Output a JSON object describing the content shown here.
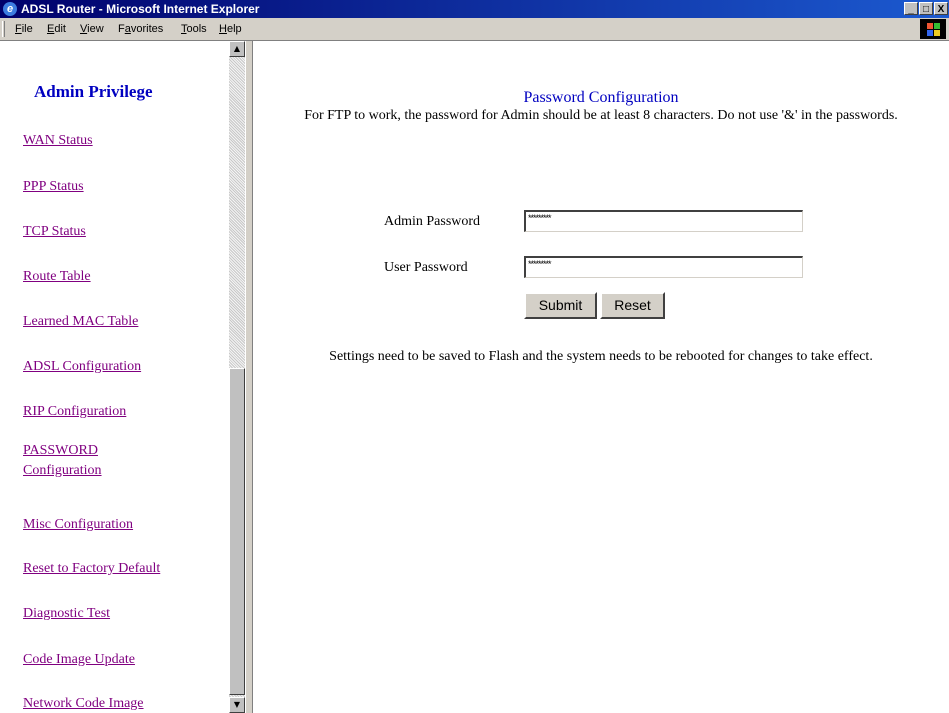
{
  "window": {
    "title": "ADSL Router - Microsoft Internet Explorer",
    "controls": [
      "_",
      "□",
      "X"
    ]
  },
  "menu": {
    "items": [
      {
        "key": "F",
        "rest": "ile"
      },
      {
        "key": "E",
        "rest": "dit"
      },
      {
        "key": "V",
        "rest": "iew"
      },
      {
        "key": "a",
        "pre": "F",
        "rest": "vorites"
      },
      {
        "key": "T",
        "rest": "ools"
      },
      {
        "key": "H",
        "rest": "elp"
      }
    ]
  },
  "sidebar": {
    "heading": "Admin Privilege",
    "links": [
      {
        "label": "WAN Status"
      },
      {
        "label": "PPP Status"
      },
      {
        "label": "TCP Status"
      },
      {
        "label": "Route Table"
      },
      {
        "label": "Learned MAC Table"
      },
      {
        "label": "ADSL Configuration"
      },
      {
        "label": "RIP Configuration"
      },
      {
        "label": "PASSWORD Configuration"
      },
      {
        "label": "Misc Configuration"
      },
      {
        "label": "Reset to Factory Default"
      },
      {
        "label": "Diagnostic Test"
      },
      {
        "label": "Code Image Update"
      },
      {
        "label": "Network Code Image"
      }
    ]
  },
  "main": {
    "title": "Password Configuration",
    "instruction": "For FTP to work, the password for Admin should be at least 8 characters. Do not use '&' in the passwords.",
    "admin_label": "Admin Password",
    "admin_value": "*********",
    "user_label": "User Password",
    "user_value": "*********",
    "submit_label": "Submit",
    "reset_label": "Reset",
    "footer_note": "Settings need to be saved to Flash and the system needs to be rebooted for changes to take effect."
  }
}
